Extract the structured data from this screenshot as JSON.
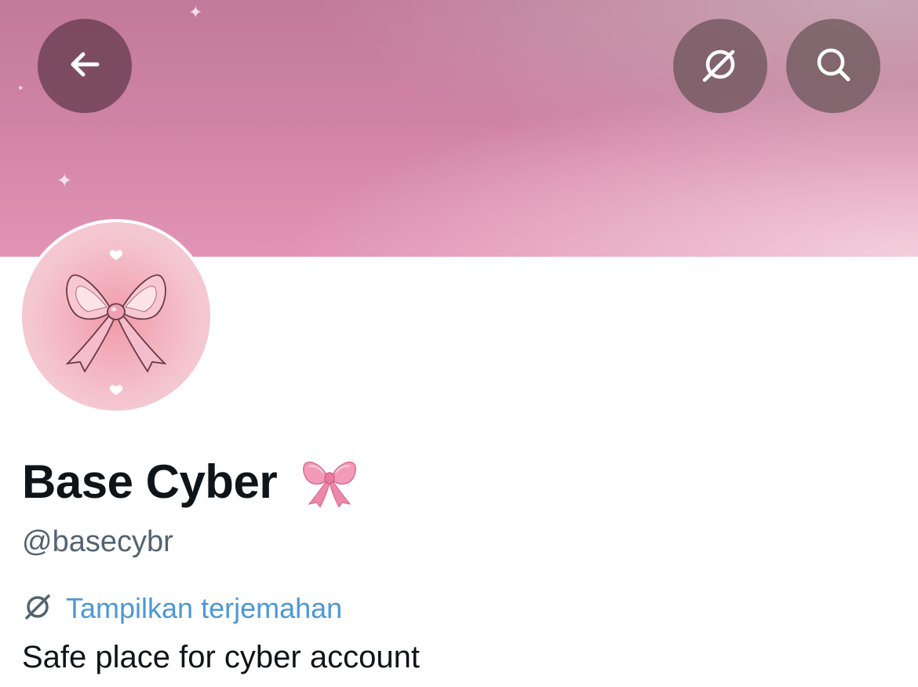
{
  "header": {
    "back_icon": "arrow-left-icon",
    "translate_icon": "translate-icon",
    "search_icon": "search-icon"
  },
  "profile": {
    "display_name": "Base Cyber",
    "display_name_emoji": "ribbon-emoji",
    "handle": "@basecybr",
    "translate_label": "Tampilkan terjemahan",
    "bio": "Safe place for cyber account"
  },
  "colors": {
    "link": "#4d97d6",
    "name_text": "#0f1419",
    "handle_text": "#536471",
    "banner_pink": "#cf83a4"
  }
}
